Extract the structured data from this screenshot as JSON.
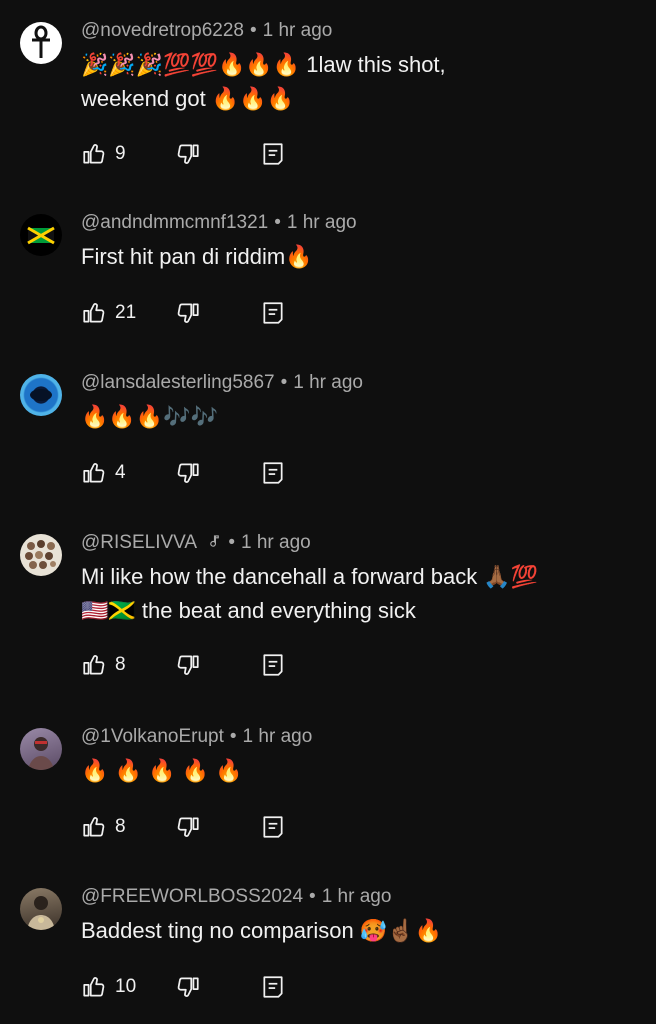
{
  "comments": [
    {
      "handle": "@novedretrop6228",
      "time": "1 hr ago",
      "text_line1": "🎉🎉🎉💯💯🔥🔥🔥 1law this shot,",
      "text_line2": "weekend got 🔥🔥🔥",
      "likes": "9",
      "avatar": "ankh-avatar"
    },
    {
      "handle": "@andndmmcmnf1321",
      "time": "1 hr ago",
      "text_line1": "First hit pan di riddim🔥",
      "likes": "21",
      "avatar": "jamaica-flag-avatar"
    },
    {
      "handle": "@lansdalesterling5867",
      "time": "1 hr ago",
      "text_line1": "🔥🔥🔥🎶🎶",
      "likes": "4",
      "avatar": "blue-hole-avatar"
    },
    {
      "handle": "@RISELIVVA",
      "time": "1 hr ago",
      "text_line1": "Mi like how the dancehall a forward back 🙏🏾💯",
      "text_line2": "🇺🇸🇯🇲 the beat and everything sick",
      "likes": "8",
      "avatar": "collage-avatar",
      "badge": "music-note-icon"
    },
    {
      "handle": "@1VolkanoErupt",
      "time": "1 hr ago",
      "text_line1": "🔥 🔥 🔥 🔥 🔥",
      "likes": "8",
      "avatar": "person-avatar"
    },
    {
      "handle": "@FREEWORLBOSS2024",
      "time": "1 hr ago",
      "text_line1": "Baddest ting no comparison 🥵☝🏾🔥",
      "likes": "10",
      "avatar": "portrait-avatar"
    }
  ],
  "colors": {
    "background": "#0f0f0f",
    "primary_text": "#f1f1f1",
    "secondary_text": "#aaaaaa"
  }
}
